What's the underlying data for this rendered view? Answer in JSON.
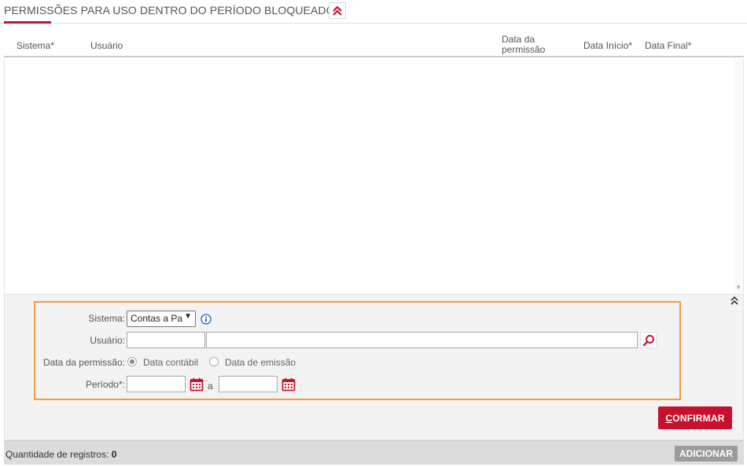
{
  "header": {
    "title": "PERMISSÕES PARA USO DENTRO DO PERÍODO BLOQUEADO",
    "collapse_icon": "double-chevron-up-icon"
  },
  "grid": {
    "columns": {
      "sistema": "Sistema*",
      "usuario": "Usuário",
      "data_permissao_line1": "Data da",
      "data_permissao_line2": "permissão",
      "data_inicio": "Data Início*",
      "data_final": "Data Final*"
    },
    "rows": []
  },
  "form": {
    "sistema_label": "Sistema:",
    "sistema_value": "Contas a Pa",
    "usuario_label": "Usuário:",
    "usuario_code_value": "",
    "usuario_name_value": "",
    "data_permissao_label": "Data da permissão:",
    "radio_options": [
      {
        "label": "Data contábil",
        "checked": true
      },
      {
        "label": "Data de emissão",
        "checked": false
      }
    ],
    "periodo_label": "Período*:",
    "periodo_sep": "a",
    "date_from_value": "",
    "date_to_value": "",
    "confirm_first_letter": "C",
    "confirm_rest": "ONFIRMAR"
  },
  "footer": {
    "count_label": "Quantidade de registros:",
    "count_value": "0",
    "add_label": "ADICIONAR"
  },
  "colors": {
    "accent": "#c8102e",
    "highlight_border": "#f39c3c",
    "info_blue": "#1e66c8"
  }
}
